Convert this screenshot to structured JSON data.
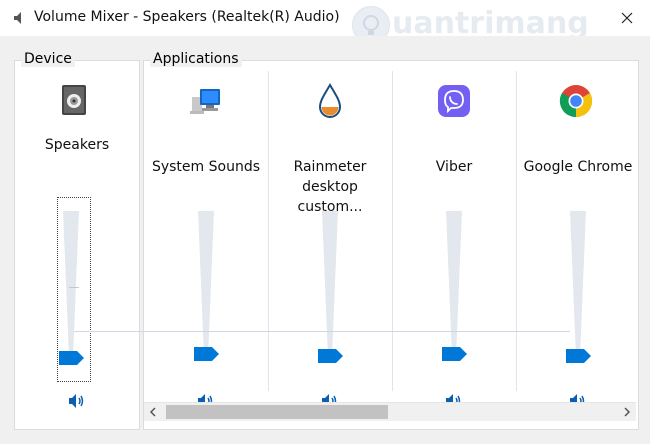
{
  "window": {
    "title": "Volume Mixer - Speakers (Realtek(R) Audio)",
    "close_icon": "close-icon",
    "title_icon": "speaker-icon"
  },
  "watermark": {
    "text": "uantrimang",
    "icon": "lightbulb-logo"
  },
  "device": {
    "group_label": "Device",
    "name": "Speakers",
    "icon": "speaker-device-icon",
    "volume_fraction": 0.0
  },
  "applications": {
    "group_label": "Applications",
    "items": [
      {
        "name": "System Sounds",
        "icon": "system-sounds-icon",
        "volume_fraction": 0.0
      },
      {
        "name_line1": "Rainmeter",
        "name_line2": "desktop custom...",
        "icon": "rainmeter-drop-icon",
        "volume_fraction": 0.0
      },
      {
        "name": "Viber",
        "icon": "viber-icon",
        "volume_fraction": 0.0
      },
      {
        "name": "Google Chrome",
        "icon": "chrome-icon",
        "volume_fraction": 0.0
      }
    ]
  },
  "colors": {
    "accent": "#0078d7",
    "track": "#e6e6e6",
    "viber": "#7360f2"
  }
}
